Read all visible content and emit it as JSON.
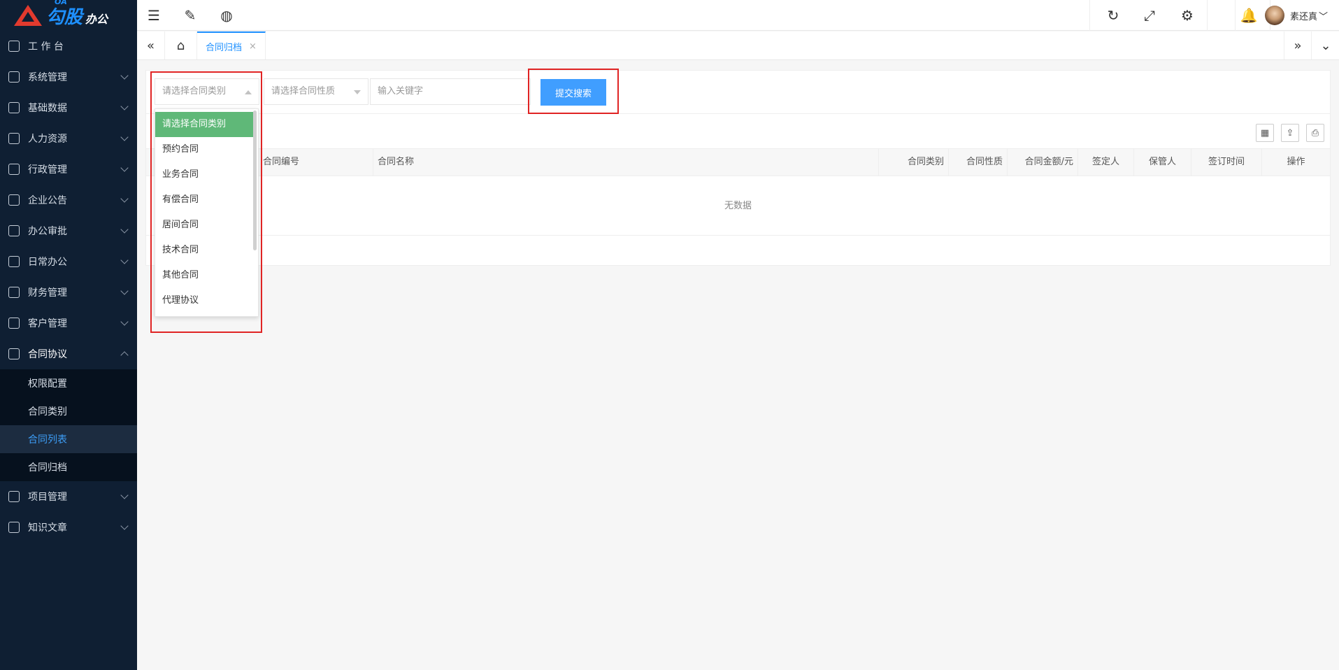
{
  "logo": {
    "oa": "OA",
    "brand": "勾股",
    "sub": "办公"
  },
  "sidebar": {
    "items": [
      {
        "label": "工 作 台",
        "icon": "dashboard-icon"
      },
      {
        "label": "系统管理",
        "icon": "system-icon"
      },
      {
        "label": "基础数据",
        "icon": "database-icon"
      },
      {
        "label": "人力资源",
        "icon": "hr-icon"
      },
      {
        "label": "行政管理",
        "icon": "admin-icon"
      },
      {
        "label": "企业公告",
        "icon": "bell-icon"
      },
      {
        "label": "办公审批",
        "icon": "approval-icon"
      },
      {
        "label": "日常办公",
        "icon": "calendar-icon"
      },
      {
        "label": "财务管理",
        "icon": "finance-icon"
      },
      {
        "label": "客户管理",
        "icon": "customer-icon"
      },
      {
        "label": "合同协议",
        "icon": "contract-icon"
      },
      {
        "label": "项目管理",
        "icon": "project-icon"
      },
      {
        "label": "知识文章",
        "icon": "article-icon"
      }
    ],
    "contract_sub": [
      "权限配置",
      "合同类别",
      "合同列表",
      "合同归档"
    ]
  },
  "user": {
    "name": "素还真"
  },
  "tabs": {
    "current": "合同归档",
    "close": "×"
  },
  "filters": {
    "category_placeholder": "请选择合同类别",
    "nature_placeholder": "请选择合同性质",
    "keyword_placeholder": "输入关键字",
    "submit": "提交搜索"
  },
  "table": {
    "columns": [
      "合同编号",
      "合同名称",
      "合同类别",
      "合同性质",
      "合同金额/元",
      "签定人",
      "保管人",
      "签订时间",
      "操作"
    ],
    "empty": "无数据"
  },
  "dropdown": {
    "options": [
      "请选择合同类别",
      "预约合同",
      "业务合同",
      "有偿合同",
      "居间合同",
      "技术合同",
      "其他合同",
      "代理协议"
    ]
  },
  "colors": {
    "sidebar_bg": "#0f1f33",
    "accent": "#1e90ff",
    "button": "#409eff",
    "selected_option": "#5fb878",
    "highlight": "#e02424"
  }
}
